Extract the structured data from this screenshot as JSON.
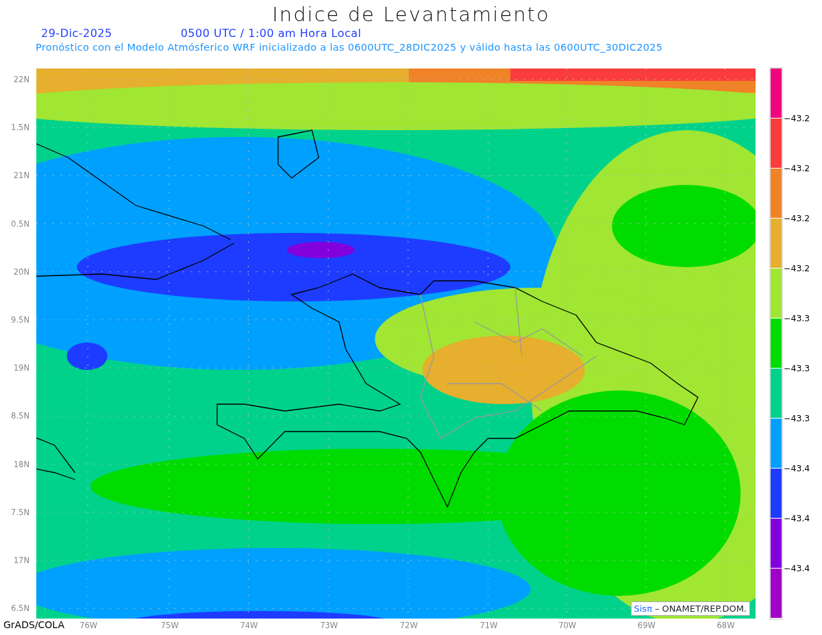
{
  "title": "Indice de Levantamiento",
  "date": "29-Dic-2025",
  "time_line": "0500 UTC / 1:00 am Hora Local",
  "subtitle": "Pronóstico con el Modelo Atmósferico WRF inicializado a las 0600UTC_28DIC2025 y válido hasta las  0600UTC_30DIC2025",
  "map": {
    "y_axis": [
      "22N",
      "1.5N",
      "21N",
      "0.5N",
      "20N",
      "9.5N",
      "19N",
      "8.5N",
      "18N",
      "7.5N",
      "17N",
      "6.5N"
    ],
    "x_axis": [
      "76W",
      "75W",
      "74W",
      "73W",
      "72W",
      "71W",
      "70W",
      "69W",
      "68W"
    ],
    "logo": {
      "symbol": "Sisπ",
      "text": "– ONAMET/REP.DOM."
    }
  },
  "colorbar": {
    "segments": [
      {
        "color": "#f0047f"
      },
      {
        "color": "#fa3c3c"
      },
      {
        "color": "#f08228"
      },
      {
        "color": "#e6af2d"
      },
      {
        "color": "#a0e632"
      },
      {
        "color": "#00dc00"
      },
      {
        "color": "#00d28c"
      },
      {
        "color": "#00a0ff"
      },
      {
        "color": "#1e3cff"
      },
      {
        "color": "#8200dc"
      },
      {
        "color": "#a000c8"
      }
    ],
    "labels": [
      "−43.2",
      "−43.2",
      "−43.2",
      "−43.2",
      "−43.3",
      "−43.3",
      "−43.3",
      "−43.4",
      "−43.4",
      "−43.4"
    ]
  },
  "credit": "GrADS/COLA"
}
